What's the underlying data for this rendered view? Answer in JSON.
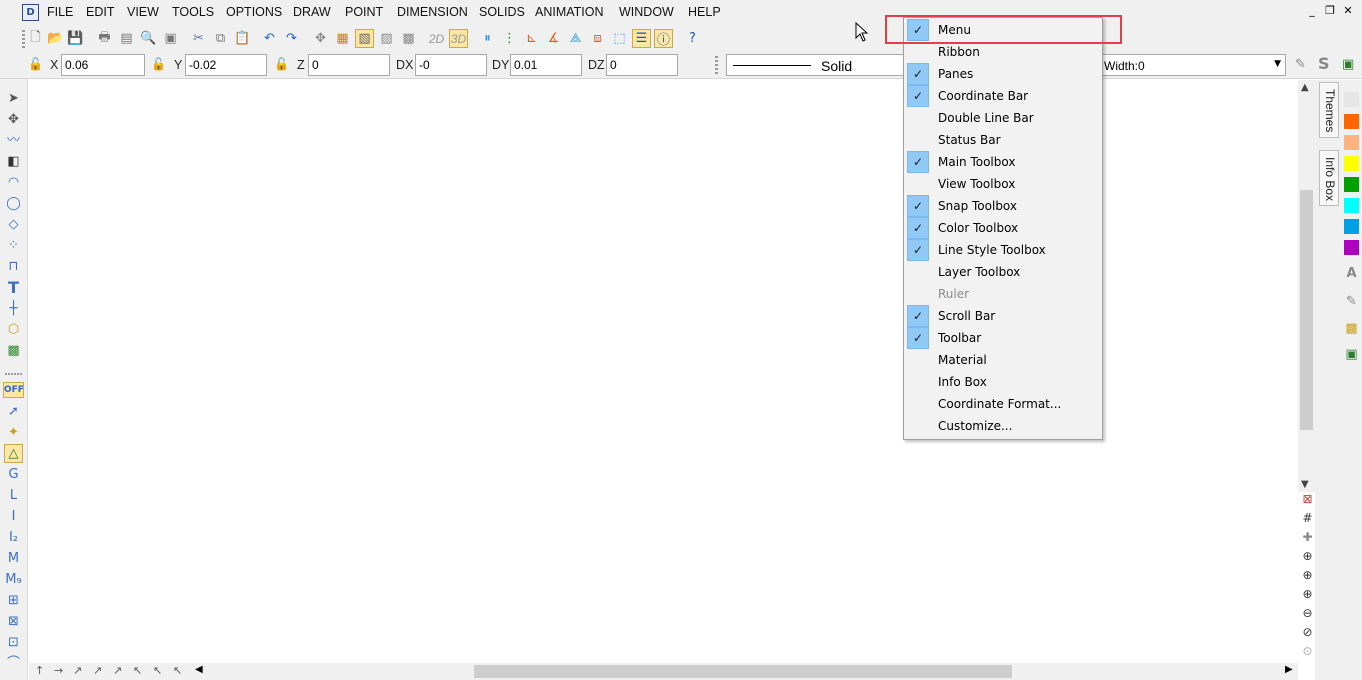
{
  "menubar": {
    "app_icon": "D",
    "items": [
      "FILE",
      "EDIT",
      "VIEW",
      "TOOLS",
      "OPTIONS",
      "DRAW",
      "POINT",
      "DIMENSION",
      "SOLIDS",
      "ANIMATION",
      "WINDOW",
      "HELP"
    ],
    "window_controls": [
      "minimize-icon",
      "restore-icon",
      "close-icon"
    ]
  },
  "toolbar": {
    "btn_2d": "2D",
    "btn_3d": "3D"
  },
  "coordbar": {
    "x_label": "X",
    "x_value": "0.06",
    "y_label": "Y",
    "y_value": "-0.02",
    "z_label": "Z",
    "z_value": "0",
    "dx_label": "DX",
    "dx_value": "-0",
    "dy_label": "DY",
    "dy_value": "0.01",
    "dz_label": "DZ",
    "dz_value": "0",
    "line_style": "Solid",
    "width": "Width:0"
  },
  "lefttools": {
    "snap_off": "OFF"
  },
  "sidetabs": {
    "themes": "Themes",
    "infobox": "Info Box"
  },
  "colors": {
    "swatches": [
      "#e6e6e6",
      "#ff6600",
      "#ffb27f",
      "#ffff00",
      "#00a000",
      "#00ffff",
      "#00a0e8",
      "#b000c0"
    ],
    "highlight_border": "#e0404a",
    "check_bg": "#90c8f6"
  },
  "context_menu": {
    "items": [
      {
        "label": "Menu",
        "checked": true
      },
      {
        "label": "Ribbon",
        "checked": false
      },
      {
        "label": "Panes",
        "checked": true
      },
      {
        "label": "Coordinate Bar",
        "checked": true
      },
      {
        "label": "Double Line Bar",
        "checked": false
      },
      {
        "label": "Status Bar",
        "checked": false
      },
      {
        "label": "Main Toolbox",
        "checked": true
      },
      {
        "label": "View Toolbox",
        "checked": false
      },
      {
        "label": "Snap Toolbox",
        "checked": true
      },
      {
        "label": "Color Toolbox",
        "checked": true
      },
      {
        "label": "Line Style Toolbox",
        "checked": true
      },
      {
        "label": "Layer Toolbox",
        "checked": false
      },
      {
        "label": "Ruler",
        "checked": false,
        "disabled": true
      },
      {
        "label": "Scroll Bar",
        "checked": true
      },
      {
        "label": "Toolbar",
        "checked": true
      },
      {
        "label": "Material",
        "checked": false
      },
      {
        "label": "Info Box",
        "checked": false
      },
      {
        "label": "Coordinate Format...",
        "checked": false
      },
      {
        "label": "Customize...",
        "checked": false
      }
    ]
  }
}
